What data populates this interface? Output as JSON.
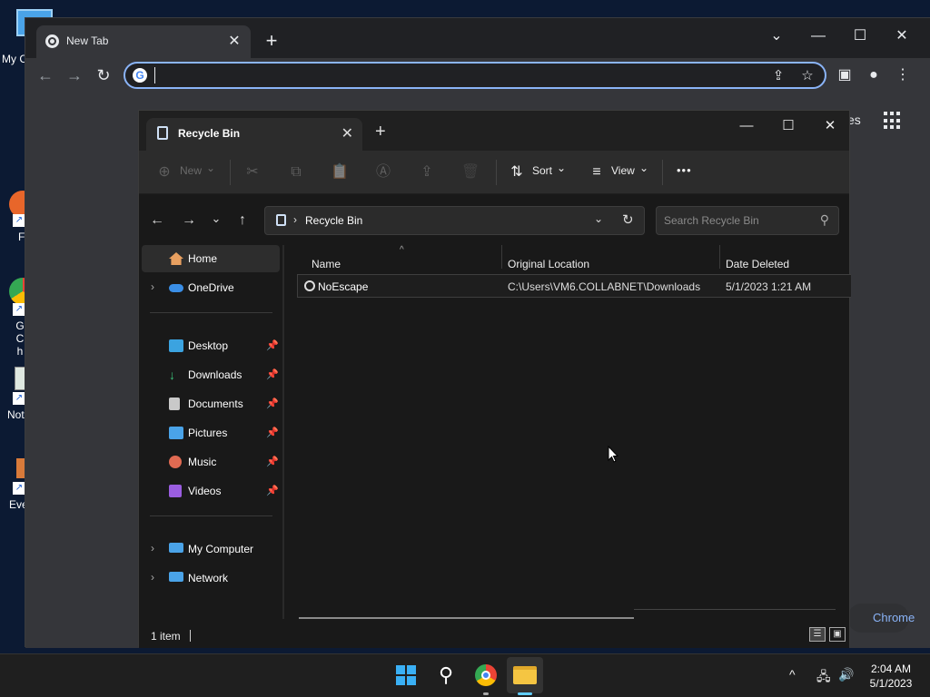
{
  "desktop": {
    "icons": [
      {
        "label": "My C"
      },
      {
        "label": "F"
      },
      {
        "label": "G Ch"
      },
      {
        "label": "Not"
      },
      {
        "label": "Eve"
      }
    ]
  },
  "chrome": {
    "tab_title": "New Tab",
    "tab_close": "✕",
    "new_tab": "+",
    "window_controls": {
      "dropdown": "⌄",
      "minimize": "—",
      "maximize": "☐",
      "close": "✕"
    },
    "nav": {
      "back": "←",
      "forward": "→",
      "reload": "↻"
    },
    "omnibox": {
      "value": "",
      "g_label": "G"
    },
    "omnibox_icons": {
      "share": "⇪",
      "bookmark": "☆"
    },
    "toolbar_icons": {
      "side_panel": "▣",
      "profile": "●",
      "menu": "⋮"
    },
    "page_text_es": "es",
    "customize_label": "Chrome",
    "accent": "#8ab4f8"
  },
  "explorer": {
    "tab_title": "Recycle Bin",
    "tab_close": "✕",
    "new_tab": "+",
    "window_controls": {
      "minimize": "—",
      "maximize": "☐",
      "close": "✕"
    },
    "commands": {
      "new_label": "New",
      "new_icon": "⊕",
      "cut_icon": "✂",
      "copy_icon": "⧉",
      "paste_icon": "📋",
      "rename_icon": "Ⓐ",
      "share_icon": "⇪",
      "delete_icon": "🗑",
      "sort_label": "Sort",
      "sort_icon": "⇅",
      "view_label": "View",
      "view_icon": "≡",
      "more_label": "•••",
      "dropdown": "⌄"
    },
    "address": {
      "nav": {
        "back": "←",
        "forward": "→",
        "recent": "⌄",
        "up": "↑"
      },
      "separator": "›",
      "location": "Recycle Bin",
      "dropdown": "⌄",
      "refresh": "↻"
    },
    "search": {
      "placeholder": "Search Recycle Bin",
      "icon": "⚲"
    },
    "nav_pane": {
      "items": [
        {
          "label": "Home",
          "chevron": "",
          "icon_color": "#e8a060",
          "pin": "",
          "selected": true
        },
        {
          "label": "OneDrive",
          "chevron": "›",
          "icon_color": "#3a8ee6",
          "pin": ""
        },
        {
          "label": "Desktop",
          "chevron": "",
          "icon_color": "#3ba3e0",
          "pin": "📌"
        },
        {
          "label": "Downloads",
          "chevron": "",
          "icon_color": "#3cc27a",
          "pin": "📌"
        },
        {
          "label": "Documents",
          "chevron": "",
          "icon_color": "#c9c9c9",
          "pin": "📌"
        },
        {
          "label": "Pictures",
          "chevron": "",
          "icon_color": "#4aa3e8",
          "pin": "📌"
        },
        {
          "label": "Music",
          "chevron": "",
          "icon_color": "#e06a52",
          "pin": "📌"
        },
        {
          "label": "Videos",
          "chevron": "",
          "icon_color": "#9a5de0",
          "pin": "📌"
        },
        {
          "label": "My Computer",
          "chevron": "›",
          "icon_color": "#4aa3e8",
          "pin": ""
        },
        {
          "label": "Network",
          "chevron": "›",
          "icon_color": "#4aa3e8",
          "pin": ""
        }
      ]
    },
    "columns": [
      "Name",
      "Original Location",
      "Date Deleted"
    ],
    "sort_caret": "^",
    "files": [
      {
        "name": "NoEscape",
        "original_location": "C:\\Users\\VM6.COLLABNET\\Downloads",
        "date_deleted": "5/1/2023 1:21 AM"
      }
    ],
    "status": {
      "count": "1 item",
      "details_view": "☰",
      "tiles_view": "▣"
    }
  },
  "taskbar": {
    "start_icon": "start-icon",
    "search_icon": "⚲",
    "tray": {
      "chevron": "^",
      "network": "🖧",
      "volume": "🔊"
    },
    "time": "2:04 AM",
    "date": "5/1/2023"
  }
}
